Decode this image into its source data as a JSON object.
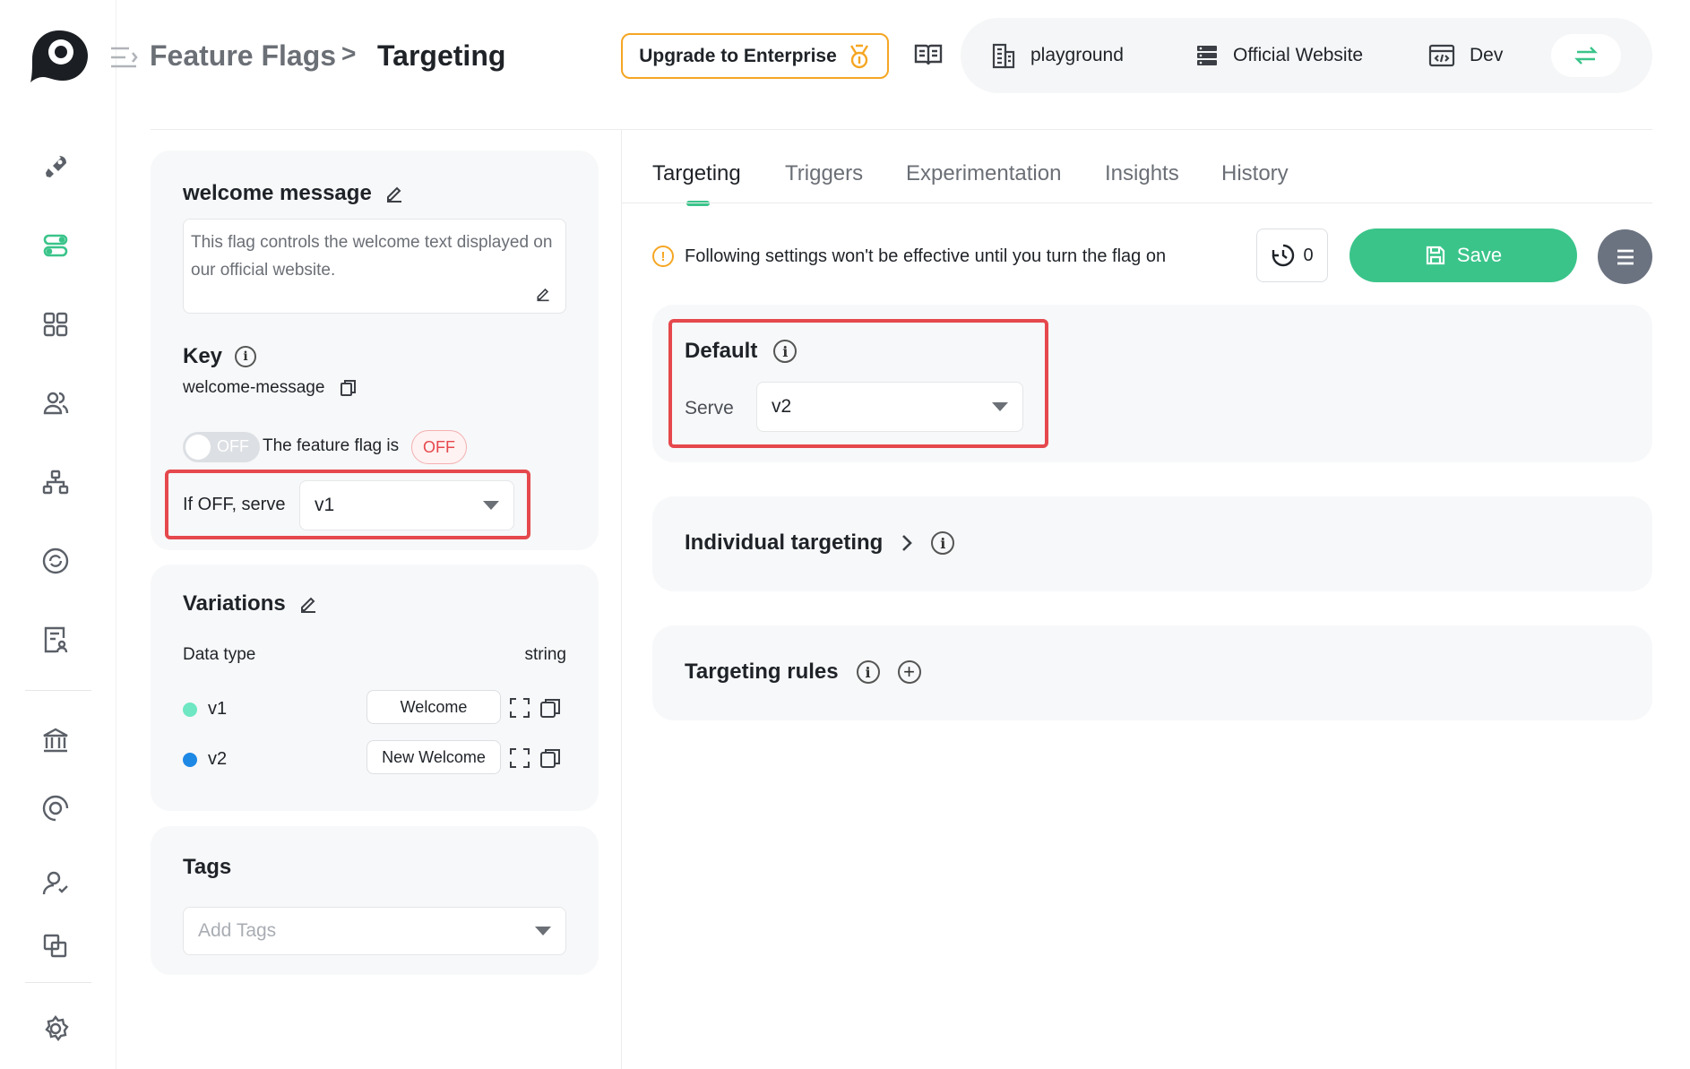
{
  "header": {
    "breadcrumb_parent": "Feature Flags",
    "breadcrumb_sep": ">",
    "breadcrumb_current": "Targeting",
    "upgrade_label": "Upgrade to Enterprise",
    "project": "playground",
    "website": "Official Website",
    "environment": "Dev"
  },
  "flag": {
    "name": "welcome message",
    "description": "This flag controls the welcome text displayed on our official website.",
    "key_label": "Key",
    "key_value": "welcome-message",
    "toggle_label": "OFF",
    "status_text": "The feature flag is",
    "status_badge": "OFF",
    "off_serve_label": "If OFF, serve",
    "off_serve_value": "v1"
  },
  "variations": {
    "title": "Variations",
    "data_type_label": "Data type",
    "data_type_value": "string",
    "items": [
      {
        "name": "v1",
        "value": "Welcome",
        "color": "#6ee7c2"
      },
      {
        "name": "v2",
        "value": "New Welcome",
        "color": "#1e88e5"
      }
    ]
  },
  "tags": {
    "title": "Tags",
    "placeholder": "Add Tags"
  },
  "tabs": [
    "Targeting",
    "Triggers",
    "Experimentation",
    "Insights",
    "History"
  ],
  "active_tab": "Targeting",
  "notice": "Following settings won't be effective until you turn the flag on",
  "schedule_count": "0",
  "save_label": "Save",
  "default_section": {
    "title": "Default",
    "serve_label": "Serve",
    "serve_value": "v2"
  },
  "individual_targeting": {
    "title": "Individual targeting"
  },
  "targeting_rules": {
    "title": "Targeting rules"
  },
  "colors": {
    "accent": "#3ac48a",
    "upgrade_border": "#f5a623",
    "highlight": "#e5484d",
    "off_badge": "#e5484d"
  }
}
